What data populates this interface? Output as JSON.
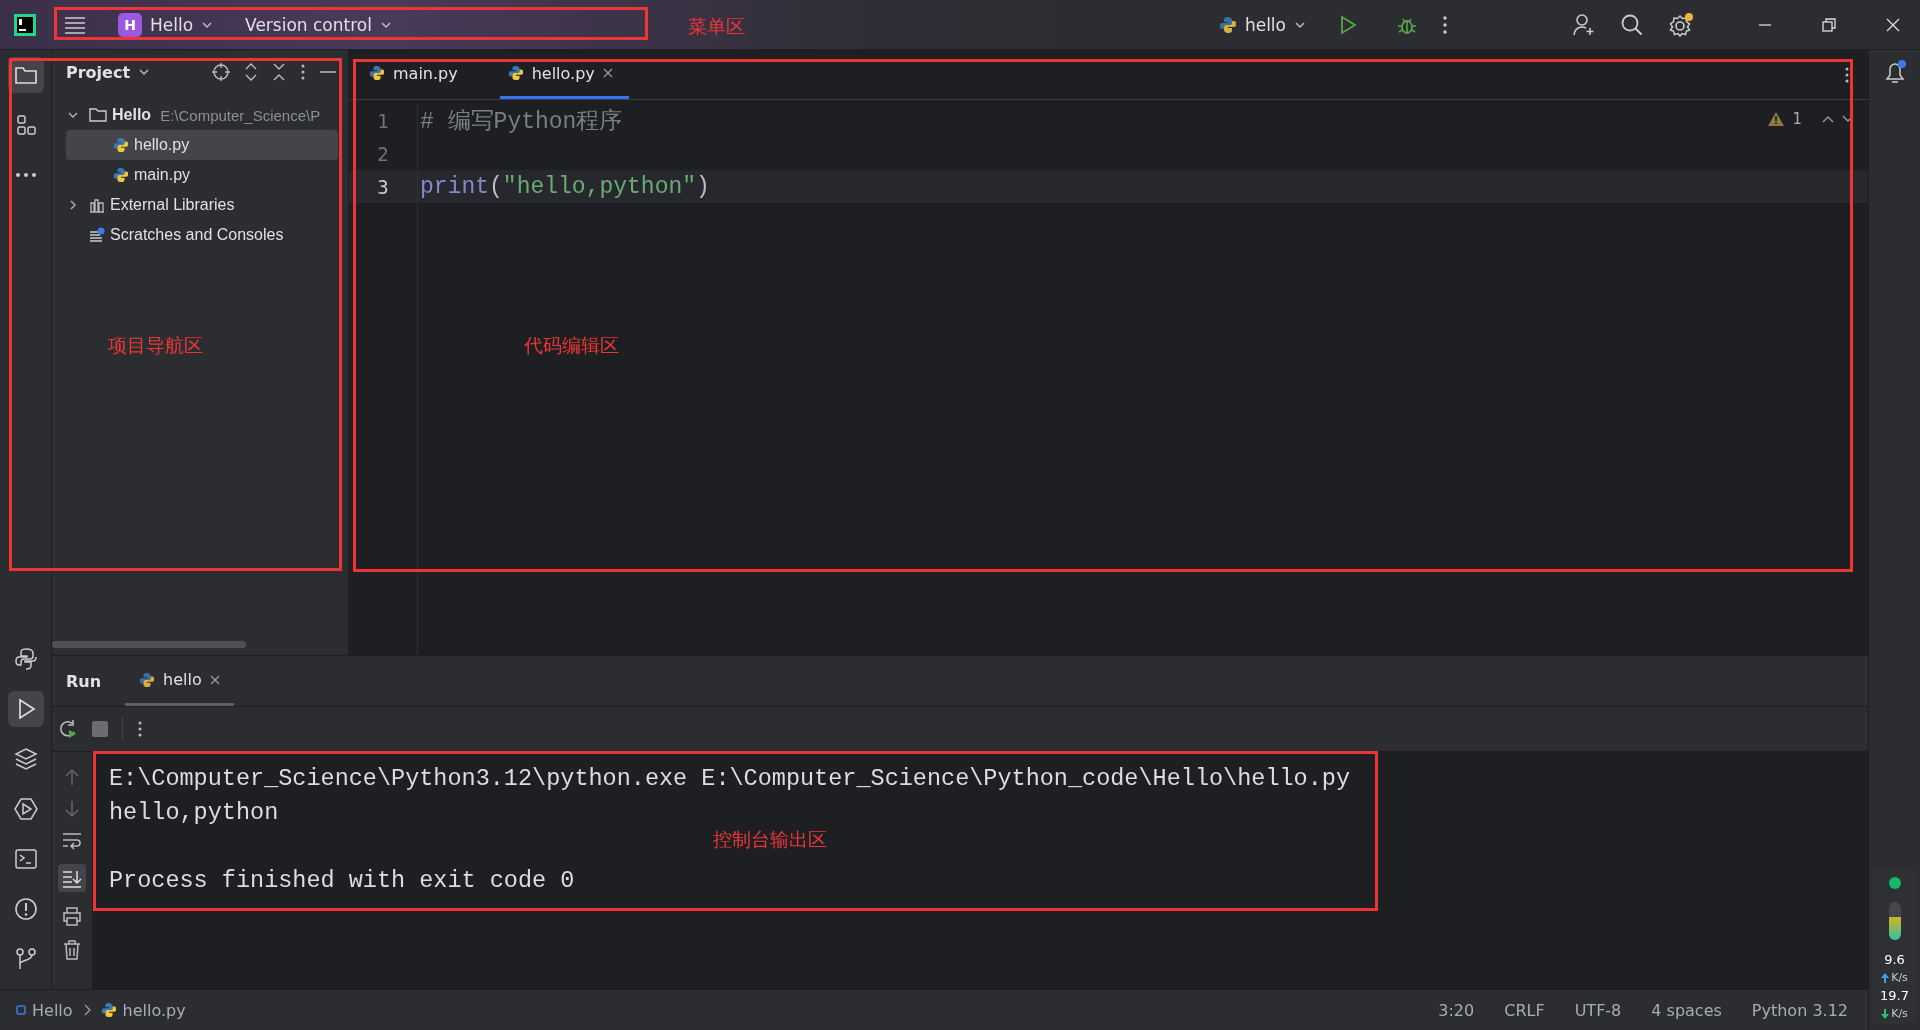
{
  "title_bar": {
    "project_badge": "H",
    "project": "Hello",
    "vcs": "Version control",
    "run_config": "hello"
  },
  "project_panel": {
    "title": "Project",
    "tree": [
      {
        "name": "Hello",
        "path": "E:\\Computer_Science\\P",
        "kind": "folder",
        "expanded": true,
        "selected": false,
        "children": [
          {
            "name": "hello.py",
            "kind": "python",
            "selected": true
          },
          {
            "name": "main.py",
            "kind": "python",
            "selected": false
          }
        ]
      },
      {
        "name": "External Libraries",
        "kind": "library",
        "expanded": false,
        "selected": false
      },
      {
        "name": "Scratches and Consoles",
        "kind": "scratches",
        "selected": false
      }
    ]
  },
  "editor": {
    "tabs": [
      {
        "label": "main.py",
        "selected": false
      },
      {
        "label": "hello.py",
        "selected": true
      }
    ],
    "warnings": "1",
    "lines": [
      {
        "number": "1",
        "current": false,
        "tokens": [
          {
            "text": "# 编写Python程序",
            "kind": "comment"
          }
        ]
      },
      {
        "number": "2",
        "current": false
      },
      {
        "number": "3",
        "current": true,
        "tokens": [
          {
            "text": "print",
            "kind": "builtin"
          },
          {
            "text": "(",
            "kind": "punct"
          },
          {
            "text": "\"hello,python\"",
            "kind": "string"
          },
          {
            "text": ")",
            "kind": "punct"
          }
        ]
      }
    ]
  },
  "run_panel": {
    "title": "Run",
    "tabs": [
      {
        "label": "hello",
        "selected": true
      }
    ],
    "output_blocks": [
      {
        "lines": [
          "E:\\Computer_Science\\Python3.12\\python.exe E:\\Computer_Science\\Python_code\\Hello\\hello.py",
          "hello,python"
        ]
      },
      {
        "lines": [
          "Process finished with exit code 0"
        ]
      }
    ]
  },
  "status_bar": {
    "breadcrumbs": [
      "Hello",
      "hello.py"
    ],
    "items": [
      "3:20",
      "CRLF",
      "UTF-8",
      "4 spaces",
      "Python 3.12"
    ]
  },
  "monitor": {
    "memory": {
      "level": 0.6
    },
    "upload": "9.6",
    "upload_unit": "K/s",
    "download": "19.7",
    "download_unit": "K/s"
  },
  "annotations": [
    {
      "label": "菜单区"
    },
    {
      "label": "项目导航区"
    },
    {
      "label": "代码编辑区"
    },
    {
      "label": "控制台输出区"
    }
  ]
}
